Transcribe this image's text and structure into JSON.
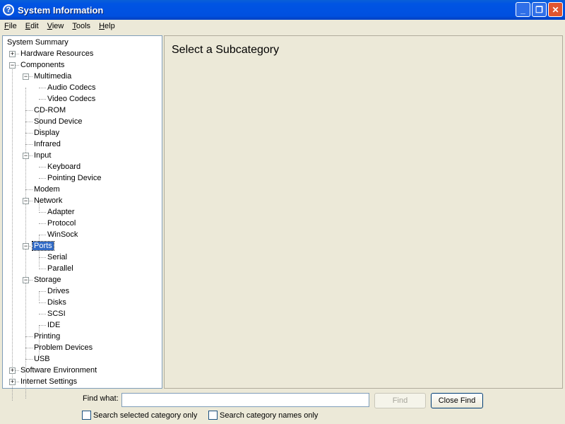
{
  "window": {
    "title": "System Information",
    "minimize": "_",
    "maximize": "❐",
    "close": "✕",
    "app_icon": "?"
  },
  "menu": [
    {
      "key": "F",
      "rest": "ile"
    },
    {
      "key": "E",
      "rest": "dit"
    },
    {
      "key": "V",
      "rest": "iew"
    },
    {
      "key": "T",
      "rest": "ools"
    },
    {
      "key": "H",
      "rest": "elp"
    }
  ],
  "tree": [
    {
      "label": "System Summary",
      "level": 0
    },
    {
      "label": "Hardware Resources",
      "level": 1,
      "exp": "+"
    },
    {
      "label": "Components",
      "level": 1,
      "exp": "-"
    },
    {
      "label": "Multimedia",
      "level": 2,
      "exp": "-"
    },
    {
      "label": "Audio Codecs",
      "level": 3
    },
    {
      "label": "Video Codecs",
      "level": 3
    },
    {
      "label": "CD-ROM",
      "level": 2
    },
    {
      "label": "Sound Device",
      "level": 2
    },
    {
      "label": "Display",
      "level": 2
    },
    {
      "label": "Infrared",
      "level": 2
    },
    {
      "label": "Input",
      "level": 2,
      "exp": "-"
    },
    {
      "label": "Keyboard",
      "level": 3
    },
    {
      "label": "Pointing Device",
      "level": 3
    },
    {
      "label": "Modem",
      "level": 2
    },
    {
      "label": "Network",
      "level": 2,
      "exp": "-"
    },
    {
      "label": "Adapter",
      "level": 3
    },
    {
      "label": "Protocol",
      "level": 3
    },
    {
      "label": "WinSock",
      "level": 3
    },
    {
      "label": "Ports",
      "level": 2,
      "exp": "-",
      "selected": true
    },
    {
      "label": "Serial",
      "level": 3
    },
    {
      "label": "Parallel",
      "level": 3
    },
    {
      "label": "Storage",
      "level": 2,
      "exp": "-"
    },
    {
      "label": "Drives",
      "level": 3
    },
    {
      "label": "Disks",
      "level": 3
    },
    {
      "label": "SCSI",
      "level": 3
    },
    {
      "label": "IDE",
      "level": 3
    },
    {
      "label": "Printing",
      "level": 2
    },
    {
      "label": "Problem Devices",
      "level": 2
    },
    {
      "label": "USB",
      "level": 2
    },
    {
      "label": "Software Environment",
      "level": 1,
      "exp": "+"
    },
    {
      "label": "Internet Settings",
      "level": 1,
      "exp": "+"
    }
  ],
  "content": {
    "heading": "Select a Subcategory"
  },
  "find": {
    "label": "Find what:",
    "value": "",
    "find_button": "Find",
    "close_button": "Close Find",
    "chk_selected": "Search selected category only",
    "chk_names": "Search category names only"
  }
}
